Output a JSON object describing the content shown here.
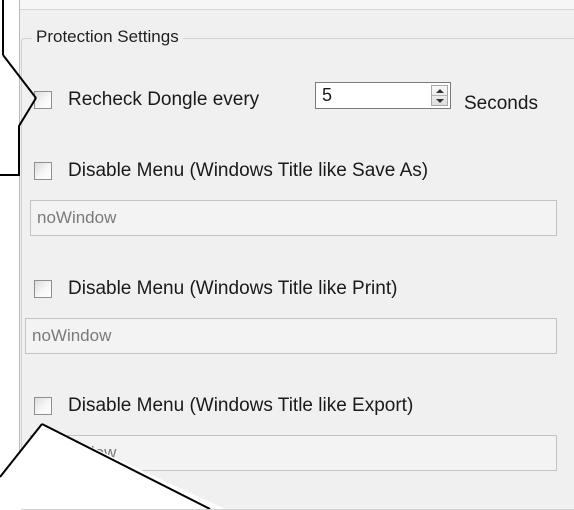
{
  "group": {
    "title": "Protection Settings"
  },
  "recheck": {
    "label": "Recheck Dongle every",
    "interval_value": "5",
    "unit_label": "Seconds"
  },
  "menus": [
    {
      "label": "Disable Menu (Windows Title like Save As)",
      "field_value": "noWindow"
    },
    {
      "label": "Disable Menu (Windows Title like Print)",
      "field_value": "noWindow"
    },
    {
      "label": "Disable Menu (Windows Title like Export)",
      "field_value": "noWindow"
    }
  ],
  "icons": {
    "spin_up": "triangle-up-icon",
    "spin_down": "triangle-down-icon"
  }
}
